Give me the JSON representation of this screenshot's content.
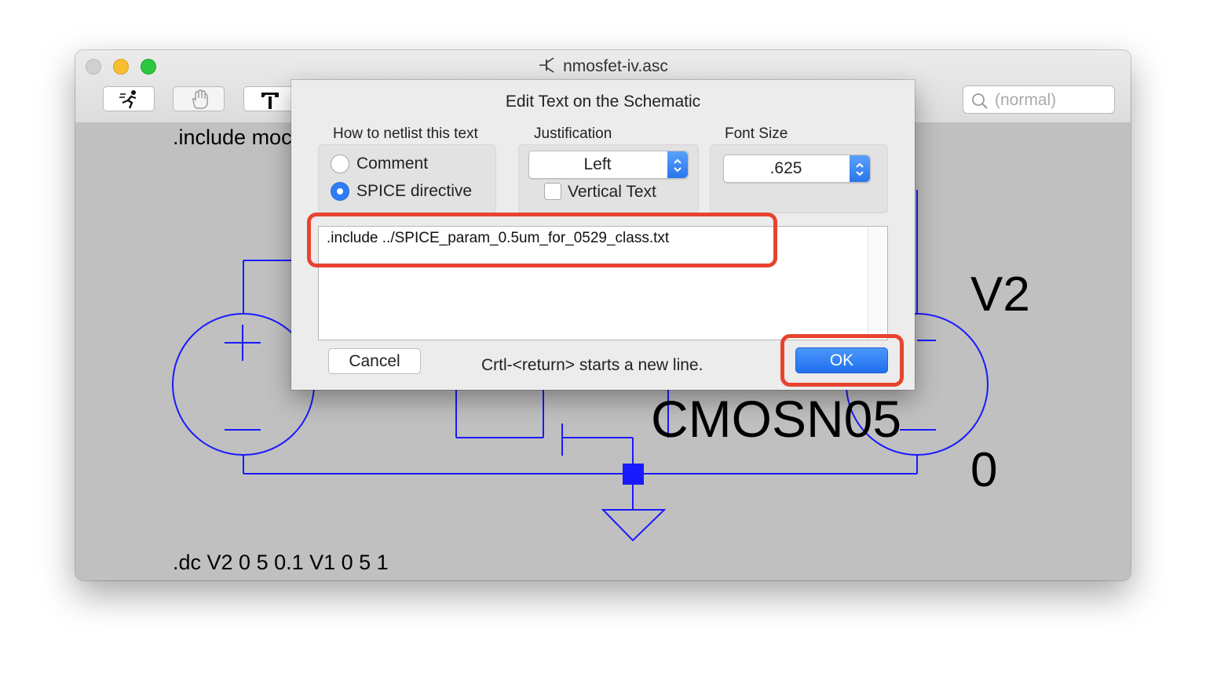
{
  "window": {
    "title": "nmosfet-iv.asc",
    "icon": "nmos-transistor-icon",
    "toolbar": [
      {
        "icon": "run-icon"
      },
      {
        "icon": "hand-pan-icon"
      },
      {
        "icon": "hammer-icon"
      }
    ],
    "search_placeholder": "(normal)"
  },
  "schematic": {
    "include_text": ".include moc",
    "dc_directive": ".dc V2 0 5 0.1 V1 0 5 1",
    "source_v2_label": "V2",
    "model_label": "CMOSN05",
    "node_label": "0",
    "wire_color": "#1a1aff",
    "background_color": "#c0c0c0"
  },
  "dialog": {
    "title": "Edit Text on the Schematic",
    "netlist_group": {
      "label": "How to netlist this text",
      "options": [
        {
          "label": "Comment",
          "selected": false
        },
        {
          "label": "SPICE directive",
          "selected": true
        }
      ]
    },
    "justification": {
      "label": "Justification",
      "value": "Left",
      "vertical_text_label": "Vertical Text",
      "vertical_text_checked": false
    },
    "font_size": {
      "label": "Font Size",
      "value": ".625"
    },
    "text_value": ".include ../SPICE_param_0.5um_for_0529_class.txt",
    "cancel_label": "Cancel",
    "hint": "Crtl-<return> starts a new line.",
    "ok_label": "OK",
    "accent_color": "#2f7cf6",
    "highlight_color": "#e8432f"
  }
}
